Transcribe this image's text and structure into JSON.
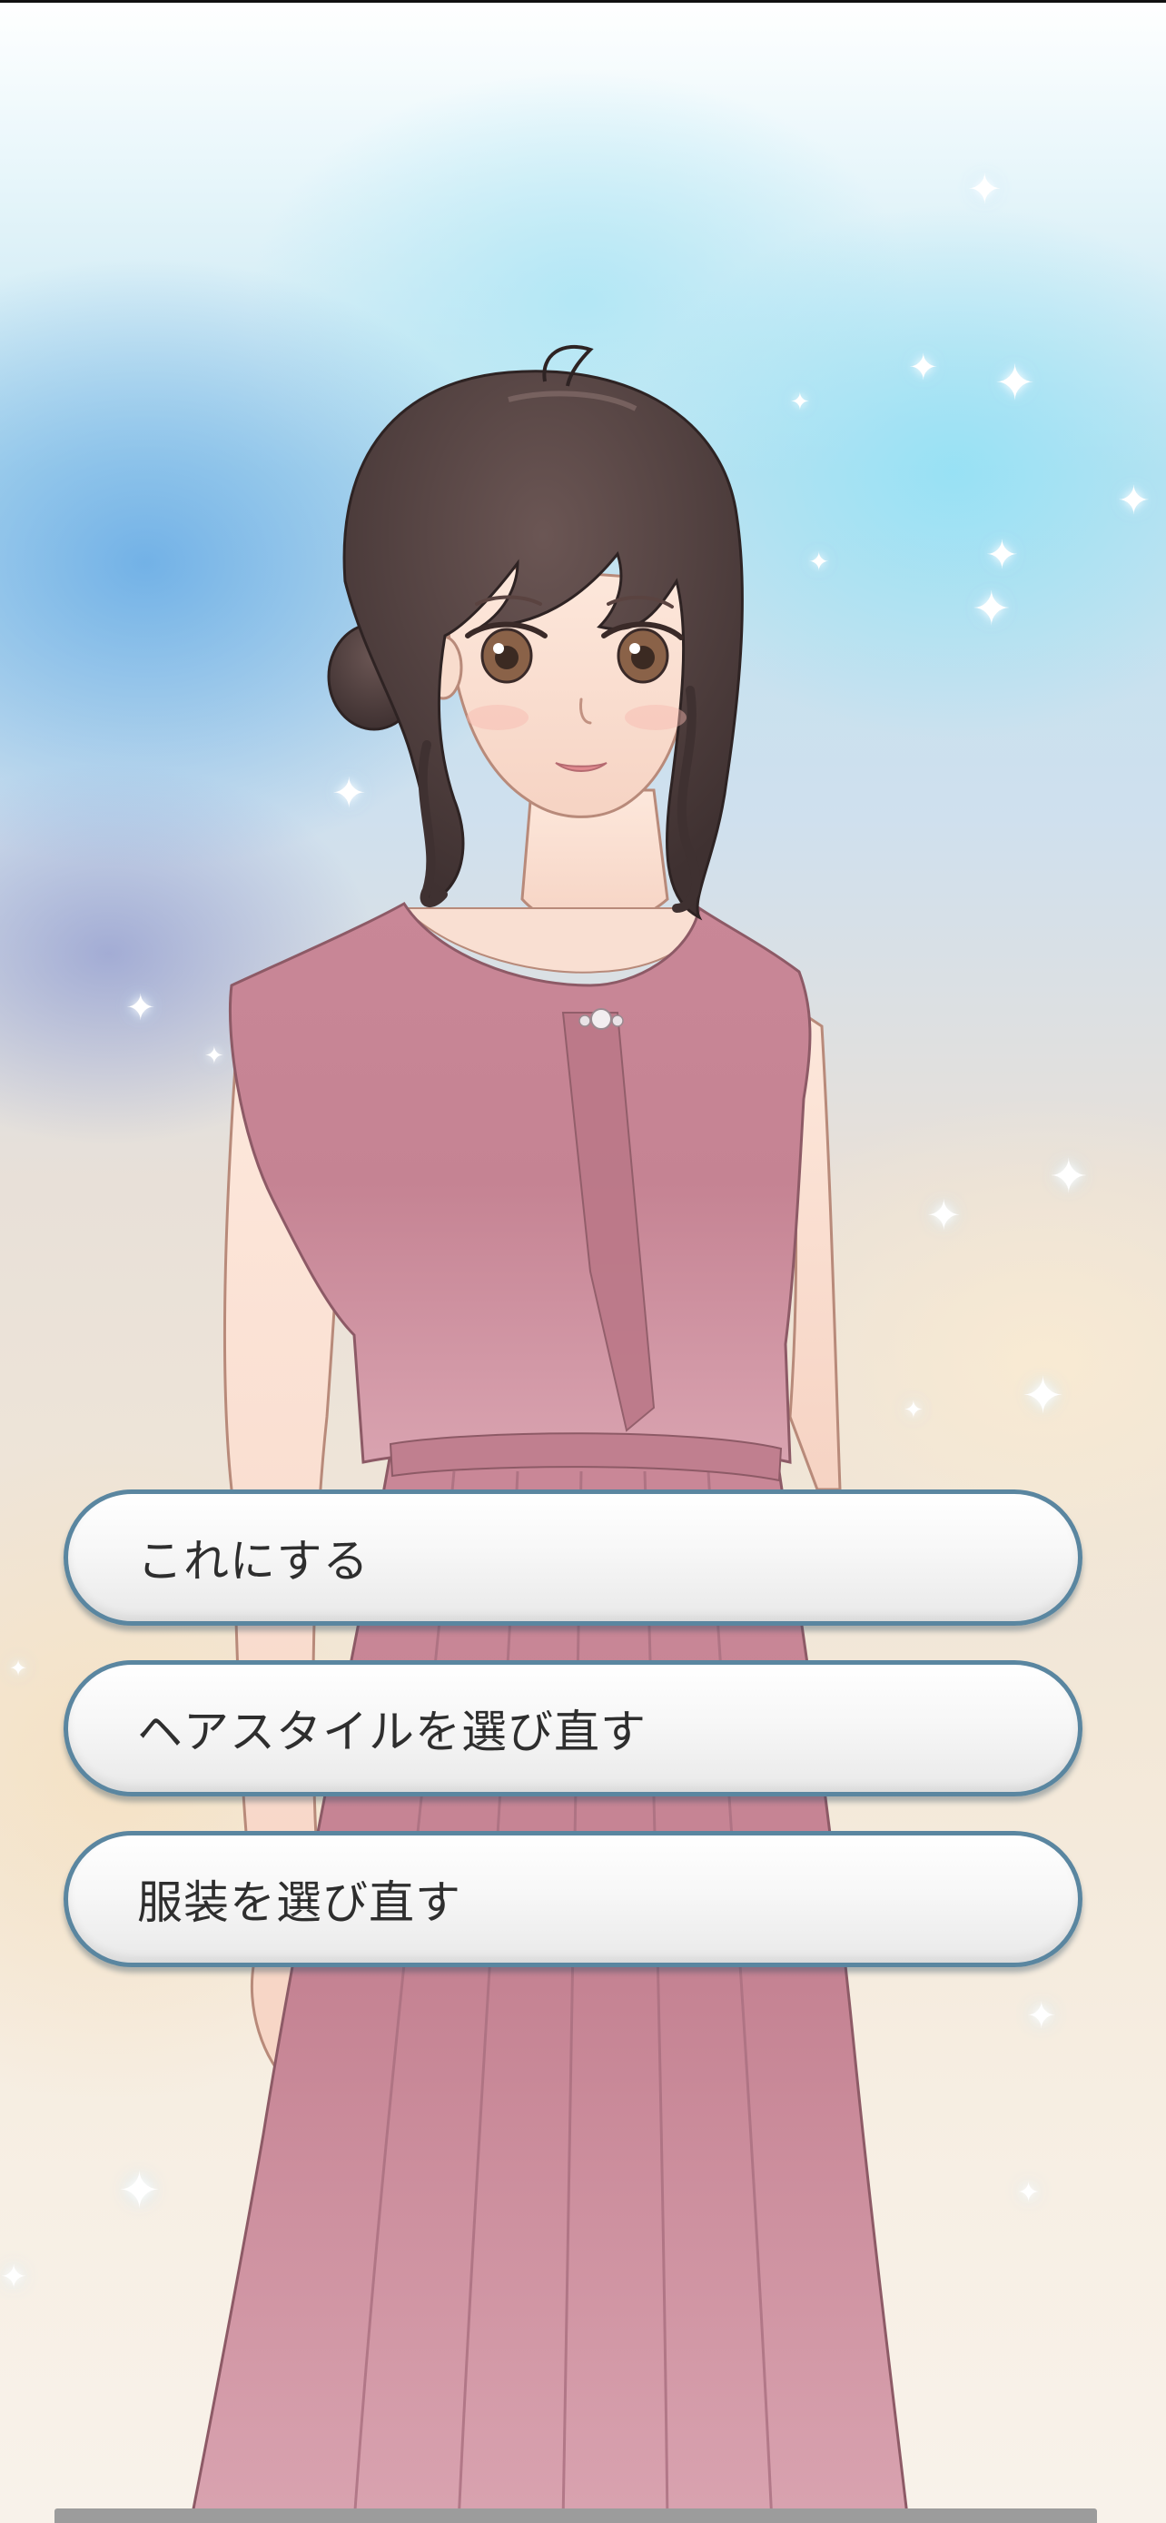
{
  "choices": [
    {
      "label": "これにする"
    },
    {
      "label": "ヘアスタイルを選び直す"
    },
    {
      "label": "服装を選び直す"
    }
  ],
  "colors": {
    "dress": "#c98797",
    "hair": "#4a3b3a",
    "skin": "#fbe3d6",
    "button_border": "#5a86a0",
    "button_text": "#2e2e2e"
  },
  "icons": {
    "sparkle": "four-point-star"
  }
}
